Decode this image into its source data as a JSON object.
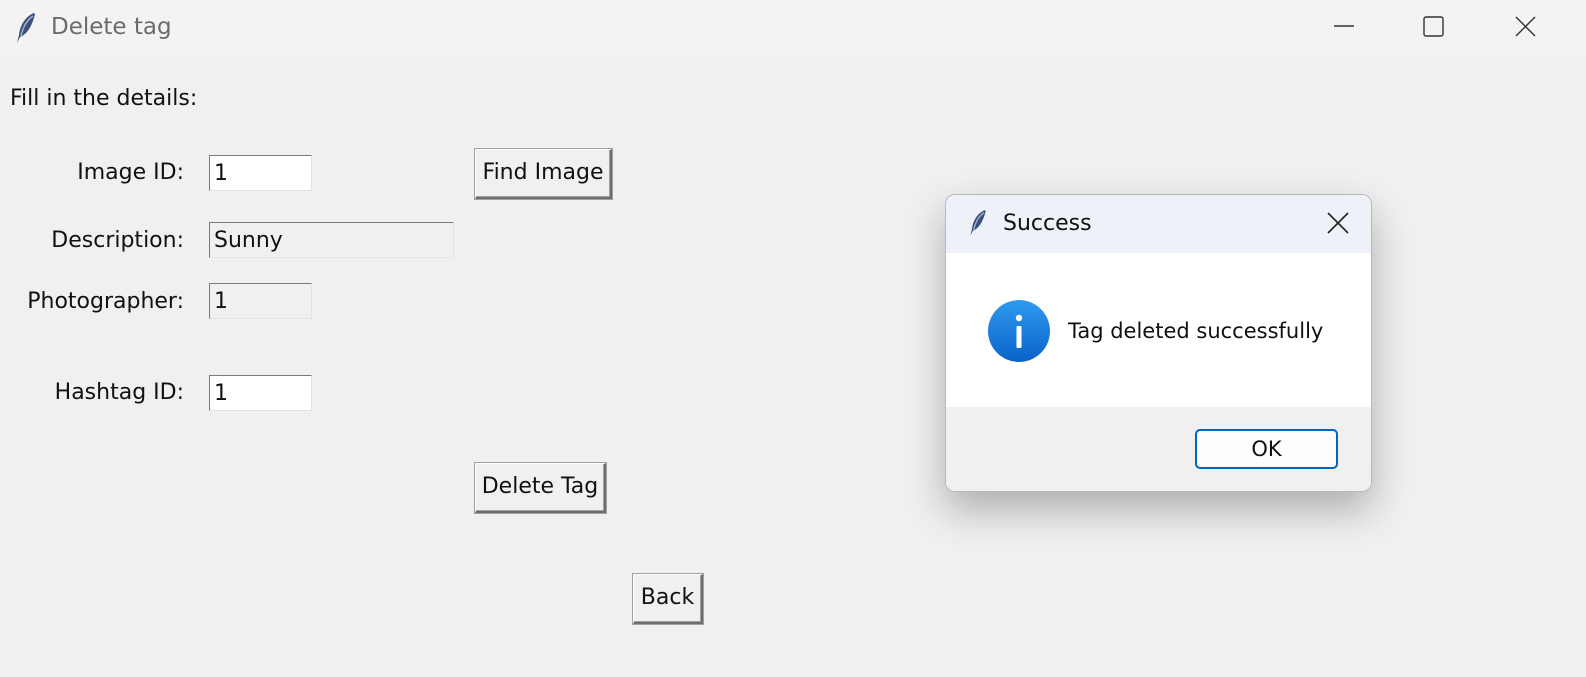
{
  "window": {
    "title": "Delete tag",
    "controls": {
      "minimize": "minimize-icon",
      "maximize": "maximize-icon",
      "close": "close-icon"
    }
  },
  "form": {
    "instruction": "Fill in the details:",
    "image_id": {
      "label": "Image ID:",
      "value": "1"
    },
    "description": {
      "label": "Description:",
      "value": "Sunny"
    },
    "photographer": {
      "label": "Photographer:",
      "value": "1"
    },
    "hashtag_id": {
      "label": "Hashtag ID:",
      "value": "1"
    },
    "find_image_label": "Find Image",
    "delete_tag_label": "Delete Tag",
    "back_label": "Back"
  },
  "dialog": {
    "title": "Success",
    "message": "Tag deleted successfully",
    "ok_label": "OK",
    "icon": "info-icon"
  },
  "colors": {
    "accent": "#0067c0",
    "info_icon": "#1e88e5",
    "window_bg": "#f0f0f0"
  }
}
